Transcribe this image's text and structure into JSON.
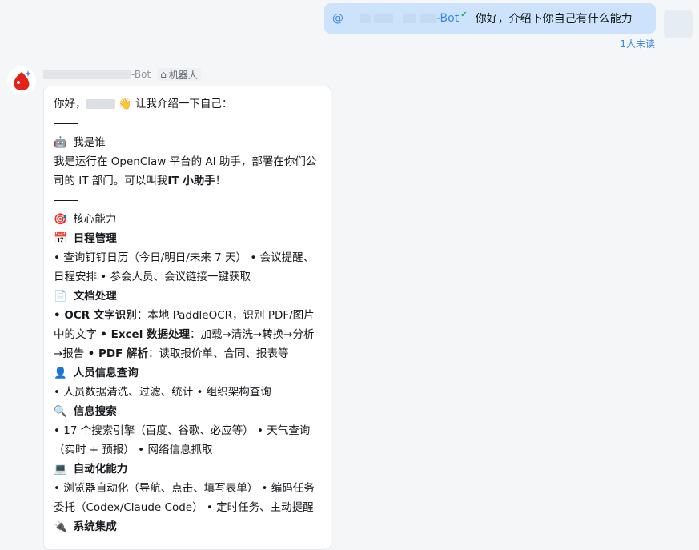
{
  "outgoing": {
    "mention_prefix": "@",
    "mention_suffix": "-Bot",
    "text": "你好，介绍下你自己有什么能力",
    "status": "1人未读"
  },
  "bot": {
    "name_suffix": "-Bot",
    "badge": "机器人"
  },
  "reply": {
    "greeting_start": "你好，",
    "wave": "👋",
    "greeting_end": " 让我介绍一下自己：",
    "s1_icon": "🤖",
    "s1_title": "我是谁",
    "s1_body_1": "我是运行在 OpenClaw 平台的 AI 助手，部署在你们公司的 IT 部门。可以叫我",
    "s1_body_bold": "IT 小助手",
    "s1_body_2": "！",
    "s2_icon": "🎯",
    "s2_title": "核心能力",
    "c1_icon": "📅",
    "c1_title": "日程管理",
    "c1_body": "• 查询钉钉日历（今日/明日/未来 7 天） • 会议提醒、日程安排 • 参会人员、会议链接一键获取",
    "c2_icon": "📄",
    "c2_title": "文档处理",
    "c2_b1": "• OCR 文字识别",
    "c2_t1": "：本地 PaddleOCR，识别 PDF/图片中的文字 ",
    "c2_b2": "• Excel 数据处理",
    "c2_t2": "：加载→清洗→转换→分析→报告 ",
    "c2_b3": "• PDF 解析",
    "c2_t3": "：读取报价单、合同、报表等",
    "c3_icon": "👤",
    "c3_title": "人员信息查询",
    "c3_body": "• 人员数据清洗、过滤、统计 • 组织架构查询",
    "c4_icon": "🔍",
    "c4_title": "信息搜索",
    "c4_body": "• 17 个搜索引擎（百度、谷歌、必应等） • 天气查询（实时 + 预报） • 网络信息抓取",
    "c5_icon": "💻",
    "c5_title": "自动化能力",
    "c5_body": "• 浏览器自动化（导航、点击、填写表单） • 编码任务委托（Codex/Claude Code） • 定时任务、主动提醒",
    "c6_icon": "🔌",
    "c6_title": "系统集成"
  }
}
